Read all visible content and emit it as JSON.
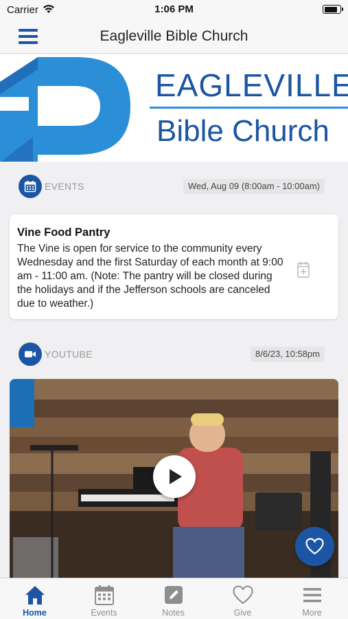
{
  "status_bar": {
    "carrier": "Carrier",
    "time": "1:06 PM",
    "battery_level": 0.9
  },
  "nav": {
    "title": "Eagleville Bible Church"
  },
  "banner": {
    "line1": "EAGLEVILLE",
    "line2": "Bible Church"
  },
  "events_section": {
    "category": "EVENTS",
    "date": "Wed, Aug 09 (8:00am - 10:00am)",
    "card": {
      "title": "Vine Food Pantry",
      "body": "The Vine is open for service to the community every Wednesday and the first Saturday of each month at 9:00 am - 11:00 am. (Note: The pantry will be closed during the holidays and if the Jefferson schools are canceled due to weather.)"
    }
  },
  "youtube_section": {
    "category": "YOUTUBE",
    "date": "8/6/23, 10:58pm"
  },
  "tabs": [
    {
      "label": "Home",
      "icon": "home-icon"
    },
    {
      "label": "Events",
      "icon": "calendar-icon"
    },
    {
      "label": "Notes",
      "icon": "notes-icon"
    },
    {
      "label": "Give",
      "icon": "heart-icon"
    },
    {
      "label": "More",
      "icon": "menu-icon"
    }
  ],
  "colors": {
    "brand": "#1b55a3",
    "accent": "#2a8fd6",
    "inactive": "#8e8e8e"
  }
}
